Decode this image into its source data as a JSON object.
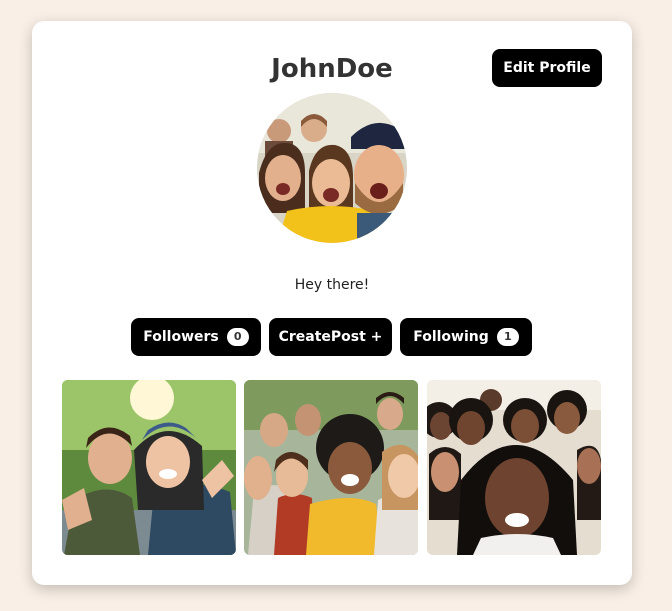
{
  "profile": {
    "username": "JohnDoe",
    "edit_label": "Edit Profile",
    "bio": "Hey there!",
    "avatar_alt": "group selfie profile picture"
  },
  "actions": {
    "followers_label": "Followers",
    "followers_count": "0",
    "create_label": "CreatePost +",
    "following_label": "Following",
    "following_count": "1"
  },
  "posts": [
    {
      "alt": "two friends taking a selfie outdoors"
    },
    {
      "alt": "large group of friends taking a selfie"
    },
    {
      "alt": "group of smiling women taking a selfie"
    }
  ],
  "colors": {
    "page_bg": "#f9efe6",
    "card_bg": "#ffffff",
    "button_bg": "#000000",
    "button_text": "#ffffff",
    "username_text": "#333333"
  }
}
